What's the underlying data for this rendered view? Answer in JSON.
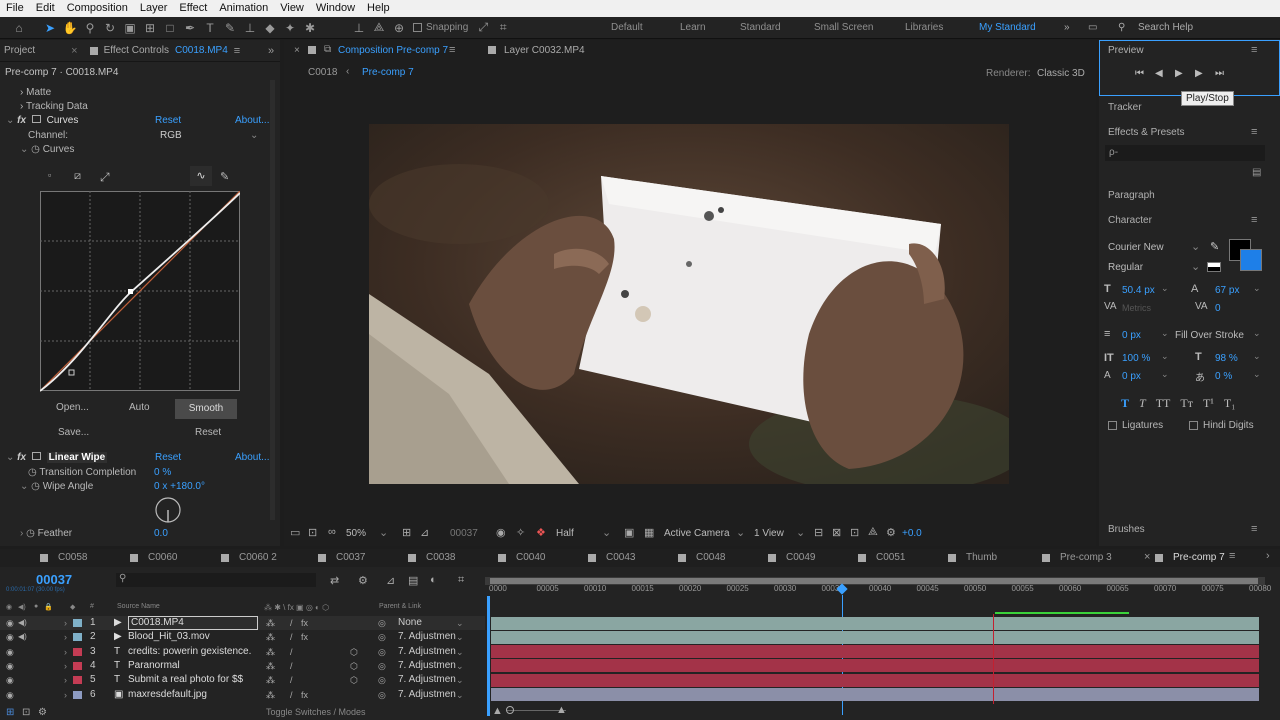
{
  "menu": [
    "File",
    "Edit",
    "Composition",
    "Layer",
    "Effect",
    "Animation",
    "View",
    "Window",
    "Help"
  ],
  "toolbar": {
    "snapping": "Snapping",
    "workspaces": [
      "Default",
      "Learn",
      "Standard",
      "Small Screen",
      "Libraries",
      "My Standard"
    ],
    "search_placeholder": "Search Help"
  },
  "left_panel": {
    "project_tab": "Project",
    "effect_controls_tab": "Effect Controls",
    "effect_controls_layer": "C0018.MP4",
    "breadcrumb": "Pre-comp 7 · C0018.MP4",
    "matte": "Matte",
    "tracking_data": "Tracking Data",
    "curves": {
      "name": "Curves",
      "reset": "Reset",
      "about": "About...",
      "channel_label": "Channel:",
      "channel_value": "RGB",
      "curves_sub": "Curves",
      "buttons": [
        "Open...",
        "Auto",
        "Smooth",
        "Save...",
        "Reset"
      ]
    },
    "linear_wipe": {
      "name": "Linear Wipe",
      "reset": "Reset",
      "about": "About...",
      "transition_label": "Transition Completion",
      "transition_value": "0 %",
      "angle_label": "Wipe Angle",
      "angle_value": "0 x +180.0°",
      "feather_label": "Feather",
      "feather_value": "0.0"
    }
  },
  "comp_viewer": {
    "tab_title": "Composition Pre-comp 7",
    "layer_tab": "Layer  C0032.MP4",
    "crumbs": [
      "C0018",
      "Pre-comp 7"
    ],
    "renderer_label": "Renderer:",
    "renderer_value": "Classic 3D",
    "footer": {
      "zoom": "50%",
      "timecode": "00037",
      "resolution": "Half",
      "camera": "Active Camera",
      "view": "1 View",
      "exposure": "+0.0"
    }
  },
  "right_panel": {
    "preview": "Preview",
    "tooltip": "Play/Stop",
    "tracker": "Tracker",
    "effects_presets": "Effects & Presets",
    "search_glyph": "ρ-",
    "paragraph": "Paragraph",
    "character": "Character",
    "font": "Courier New",
    "style": "Regular",
    "size": "50.4 px",
    "leading": "67 px",
    "kerning": "Metrics",
    "tracking": "0",
    "stroke_width": "0 px",
    "stroke_type": "Fill Over Stroke",
    "vscale": "100 %",
    "hscale": "98 %",
    "baseline": "0 px",
    "tsume": "0 %",
    "ligatures": "Ligatures",
    "hindi_digits": "Hindi Digits",
    "brushes": "Brushes"
  },
  "comp_tabs": [
    "C0058",
    "C0060",
    "C0060 2",
    "C0037",
    "C0038",
    "C0040",
    "C0043",
    "C0048",
    "C0049",
    "C0051",
    "Thumb",
    "Pre-comp 3",
    "Pre-comp 7"
  ],
  "timeline": {
    "current_time": "00037",
    "sub_time": "0:00:01:07 (30.00 fps)",
    "col_source": "Source Name",
    "col_parent": "Parent & Link",
    "ruler": [
      "0000",
      "00005",
      "00010",
      "00015",
      "00020",
      "00025",
      "00030",
      "00035",
      "00040",
      "00045",
      "00050",
      "00055",
      "00060",
      "00065",
      "00070",
      "00075",
      "00080"
    ],
    "toggle": "Toggle Switches / Modes",
    "layers": [
      {
        "num": "1",
        "name": "C0018.MP4",
        "type": "▶",
        "parent": "None",
        "label": "#7fb0c8",
        "bar": "#8aa6a2"
      },
      {
        "num": "2",
        "name": "Blood_Hit_03.mov",
        "type": "▶",
        "parent": "7. Adjustmen",
        "label": "#7fb0c8",
        "bar": "#8aa6a2"
      },
      {
        "num": "3",
        "name": "credits: powerin gexistence.",
        "type": "T",
        "parent": "7. Adjustmen",
        "label": "#c43c54",
        "bar": "#a33348"
      },
      {
        "num": "4",
        "name": "Paranormal",
        "type": "T",
        "parent": "7. Adjustmen",
        "label": "#c43c54",
        "bar": "#a33348"
      },
      {
        "num": "5",
        "name": "Submit a real photo for $$",
        "type": "T",
        "parent": "7. Adjustmen",
        "label": "#c43c54",
        "bar": "#a33348"
      },
      {
        "num": "6",
        "name": "maxresdefault.jpg",
        "type": "▣",
        "parent": "7. Adjustmen",
        "label": "#8d9bc2",
        "bar": "#8b8fa8"
      }
    ]
  },
  "colors": {
    "accent": "#3aa0ff",
    "curve": "#e8e8e8",
    "diag": "#c0603a"
  }
}
